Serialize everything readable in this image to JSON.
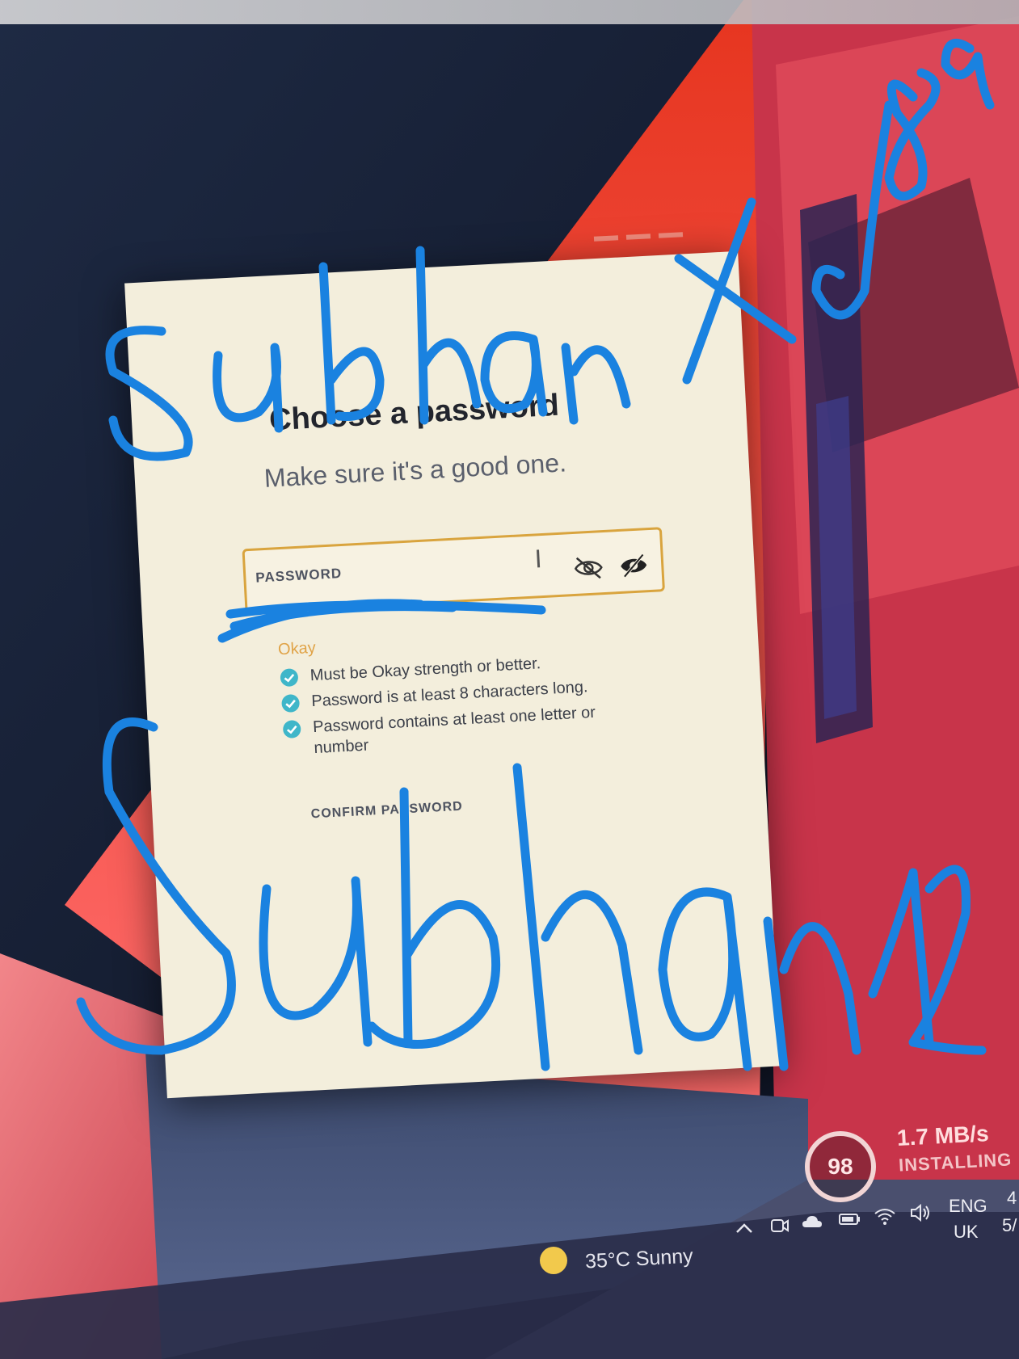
{
  "dialog": {
    "title": "Choose a password",
    "subtitle": "Make sure it's a good one.",
    "password_field": {
      "label": "PASSWORD",
      "value": "",
      "icons": [
        "eye-slash-icon",
        "eye-slash-filled-icon"
      ]
    },
    "strength_label": "Okay",
    "requirements": [
      {
        "text": "Must be Okay strength or better.",
        "met": true
      },
      {
        "text": "Password is at least 8 characters long.",
        "met": true
      },
      {
        "text": "Password contains at least one letter or number",
        "met": true
      }
    ],
    "confirm_field": {
      "label": "CONFIRM PASSWORD",
      "value": ""
    }
  },
  "installer": {
    "progress_number": "98",
    "speed": "1.7 MB/s",
    "status": "INSTALLING"
  },
  "taskbar": {
    "weather": "35°C  Sunny",
    "weather_icon": "sun-icon",
    "tray_icons": [
      "chevron-up-icon",
      "meet-icon",
      "cloud-icon",
      "battery-icon",
      "wifi-icon",
      "speaker-icon"
    ],
    "language_line1": "ENG",
    "language_line2": "UK",
    "clock_line1": "4",
    "clock_line2": "5/"
  },
  "handwriting": {
    "top_text": "Subhan X",
    "top_right_text": "J89",
    "bottom_text": "Subhan12"
  },
  "colors": {
    "dialog_bg": "#f3eedc",
    "field_border": "#d9a43e",
    "strength": "#e0a347",
    "check": "#3fb6c9",
    "pen": "#1a82e0",
    "bg_red": "#e0321f"
  }
}
